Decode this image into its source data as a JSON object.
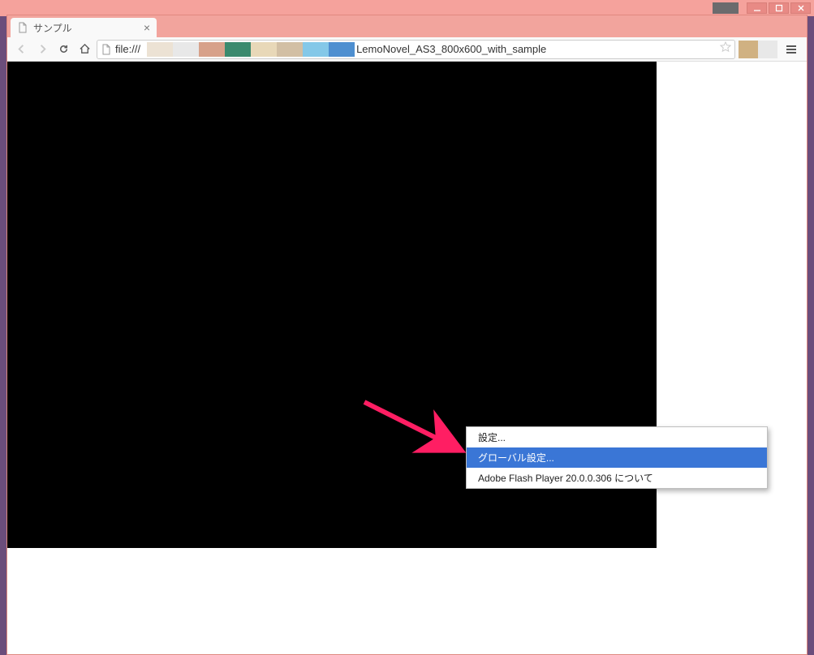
{
  "window": {
    "tab_title": "サンプル",
    "url_scheme": "file:///",
    "url_file": "LemoNovel_AS3_800x600_with_sample"
  },
  "palette_swatches": [
    "#ece2d4",
    "#e8e8e8",
    "#d7a18a",
    "#3b8a6e",
    "#e8d8b8",
    "#d2bfa4",
    "#84c8e8",
    "#4e8fd0"
  ],
  "ext_colors": [
    "#d0b182",
    "#e8e8e8"
  ],
  "context_menu": {
    "items": [
      {
        "label": "設定...",
        "highlighted": false
      },
      {
        "label": "グローバル設定...",
        "highlighted": true
      },
      {
        "label": "Adobe Flash Player 20.0.0.306  について",
        "highlighted": false
      }
    ]
  },
  "arrow_color": "#ff1e63"
}
